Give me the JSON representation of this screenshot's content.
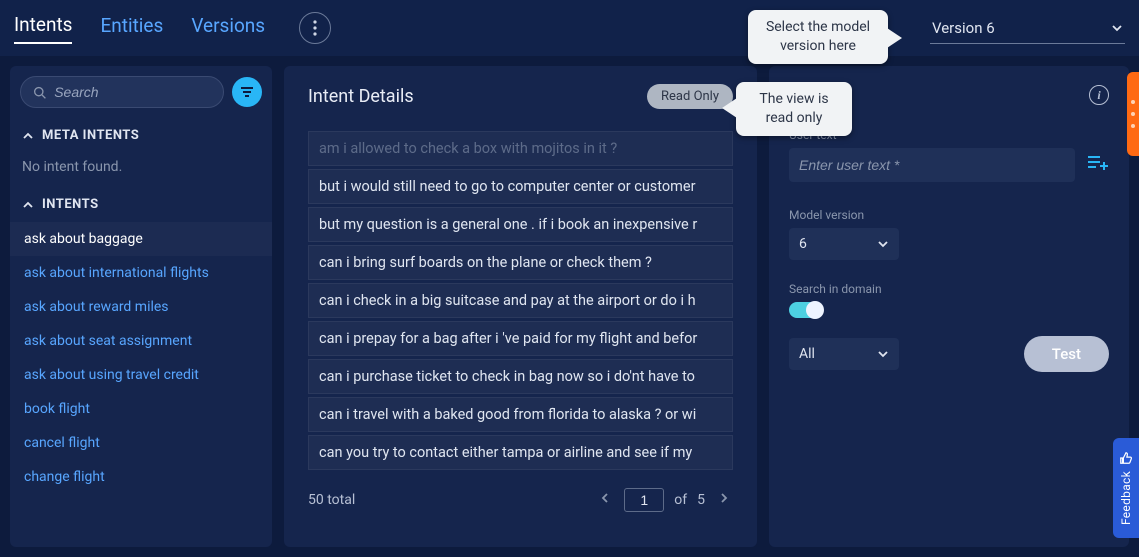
{
  "header": {
    "tabs": {
      "intents": "Intents",
      "entities": "Entities",
      "versions": "Versions"
    },
    "active_tab": "intents",
    "version_selected": "Version 6"
  },
  "callouts": {
    "select_model": "Select the model version here",
    "read_only_view": "The view is read only"
  },
  "sidebar": {
    "search_placeholder": "Search",
    "sections": {
      "meta_intents": {
        "label": "META INTENTS",
        "empty_text": "No intent found."
      },
      "intents": {
        "label": "INTENTS",
        "items": [
          "ask about baggage",
          "ask about international flights",
          "ask about reward miles",
          "ask about seat assignment",
          "ask about using travel credit",
          "book flight",
          "cancel flight",
          "change flight"
        ],
        "selected_index": 0
      }
    }
  },
  "details": {
    "title": "Intent Details",
    "readonly_label": "Read Only",
    "utterances": [
      "am i allowed to check a box with mojitos in it ?",
      "but i would still need to go to computer center or customer",
      "but my question is a general one . if i book an inexpensive r",
      "can i bring surf boards on the plane or check them ?",
      "can i check in a big suitcase and pay at the airport or do i h",
      "can i prepay for a bag after i 've paid for my flight and befor",
      "can i purchase ticket to check in bag now so i do'nt have to",
      "can i travel with a baked good from florida to alaska ? or wi",
      "can you try to contact either tampa or airline and see if my"
    ],
    "pager": {
      "total_label": "50 total",
      "current_page": "1",
      "of_label": "of",
      "total_pages": "5"
    }
  },
  "test_panel": {
    "user_text_label": "User text",
    "user_text_placeholder": "Enter user text *",
    "model_version_label": "Model version",
    "model_version_value": "6",
    "search_in_domain_label": "Search in domain",
    "search_in_domain_on": true,
    "domain_filter_value": "All",
    "test_button": "Test"
  },
  "feedback": {
    "label": "Feedback"
  }
}
